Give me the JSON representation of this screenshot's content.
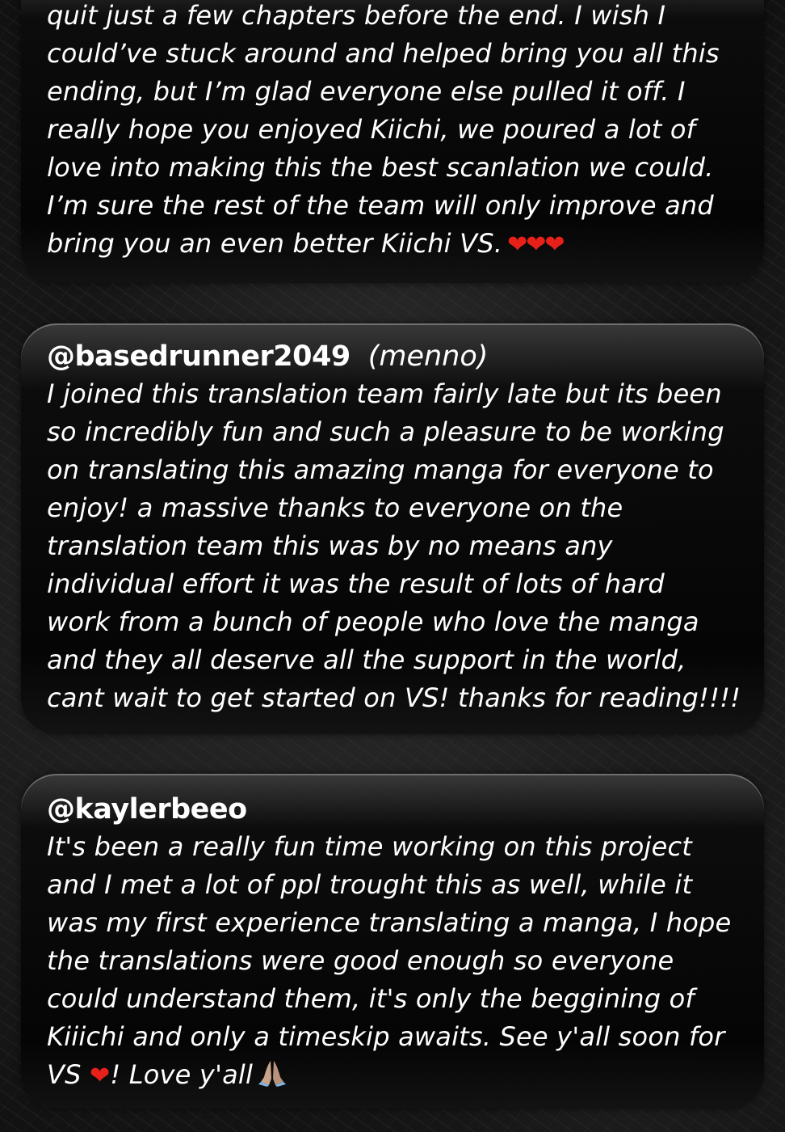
{
  "cards": [
    {
      "body": "quit just a few chapters before the end. I wish I\ncould’ve stuck around and helped bring you all this\nending, but I’m glad everyone else pulled it off. I\nreally hope you enjoyed Kiichi, we poured a lot of\nlove into making this the best scanlation we could.\nI’m sure the rest of the team will only improve and\nbring you an even better Kiichi VS.",
      "hearts": "❤❤❤"
    },
    {
      "handle": "@basedrunner2049",
      "nickname": "(menno)",
      "body": "I joined this translation team fairly late but its been\nso incredibly fun and such a pleasure to be working\non translating this amazing manga for everyone to\nenjoy! a massive thanks to everyone on the\ntranslation team this was by no means any\nindividual effort it was the result of lots of hard\nwork from a bunch of people who love the manga\nand they all deserve all the support in the world,\ncant wait to get started on VS! thanks for reading!!!!"
    },
    {
      "handle": "@kaylerbeeo",
      "body_main": "It's been a really fun time working on this project\nand I met a lot of ppl trought this as well, while it\nwas my first experience translating a manga, I hope\nthe translations were good enough so everyone\ncould understand them, it's only the beggining of\nKiiichi and only a timeskip awaits. See y'all soon for\nVS",
      "heart": "❤",
      "body_end": "! Love y'all",
      "emoji_icon": "folded-hands-icon"
    }
  ],
  "colors": {
    "text": "#ffffff",
    "heart": "#e8201a",
    "card": "#050505"
  }
}
